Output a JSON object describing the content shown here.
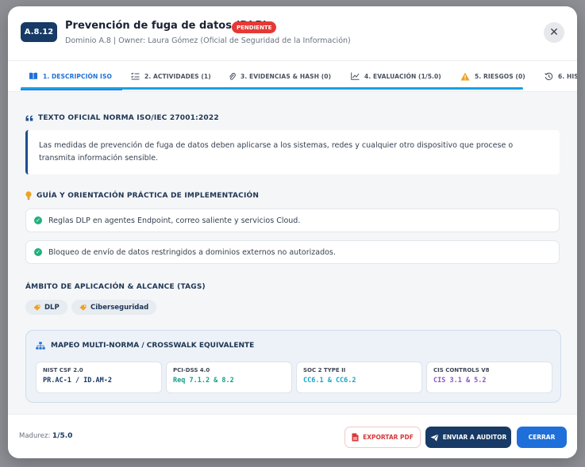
{
  "header": {
    "code": "A.8.12",
    "title": "Prevención de fuga de datos (DLP)",
    "status": "PENDIENTE",
    "subtitle": "Dominio A.8 | Owner: Laura Gómez (Oficial de Seguridad de la Información)",
    "close_symbol": "✕"
  },
  "tabs": [
    {
      "label": "1. DESCRIPCIÓN ISO",
      "icon": "book-icon",
      "active": true
    },
    {
      "label": "2. ACTIVIDADES (1)",
      "icon": "list-check-icon"
    },
    {
      "label": "3. EVIDENCIAS & HASH (0)",
      "icon": "paperclip-icon"
    },
    {
      "label": "4. EVALUACIÓN (1/5.0)",
      "icon": "chart-line-icon"
    },
    {
      "label": "5. RIESGOS (0)",
      "icon": "warning-icon"
    },
    {
      "label": "6. HIS",
      "icon": "history-icon"
    }
  ],
  "sections": {
    "norm_title": "TEXTO OFICIAL NORMA ISO/IEC 27001:2022",
    "norm_text": "Las medidas de prevención de fuga de datos deben aplicarse a los sistemas, redes y cualquier otro dispositivo que procese o transmita información sensible.",
    "guide_title": "GUÍA Y ORIENTACIÓN PRÁCTICA DE IMPLEMENTACIÓN",
    "guide_items": [
      "Reglas DLP en agentes Endpoint, correo saliente y servicios Cloud.",
      "Bloqueo de envío de datos restringidos a dominios externos no autorizados."
    ],
    "scope_title": "ÁMBITO DE APLICACIÓN & ALCANCE (TAGS)",
    "tags": [
      "DLP",
      "Ciberseguridad"
    ],
    "crosswalk_title": "MAPEO MULTI-NORMA / CROSSWALK EQUIVALENTE",
    "crosswalk": [
      {
        "name": "NIST CSF 2.0",
        "value": "PR.AC-1 / ID.AM-2",
        "color": "#173a66"
      },
      {
        "name": "PCI-DSS 4.0",
        "value": "Req 7.1.2 & 8.2",
        "color": "#14a085"
      },
      {
        "name": "SOC 2 TYPE II",
        "value": "CC6.1 & CC6.2",
        "color": "#16a3c4"
      },
      {
        "name": "CIS CONTROLS V8",
        "value": "CIS 3.1 & 5.2",
        "color": "#8e52c7"
      }
    ]
  },
  "footer": {
    "maturity_label": "Madurez:",
    "maturity_value": "1/5.0",
    "export_label": "EXPORTAR PDF",
    "send_label": "ENVIAR A AUDITOR",
    "close_label": "CERRAR"
  },
  "colors": {
    "accent": "#1e6fd9",
    "primary": "#173a66",
    "danger": "#e53935",
    "success": "#22b07d"
  }
}
